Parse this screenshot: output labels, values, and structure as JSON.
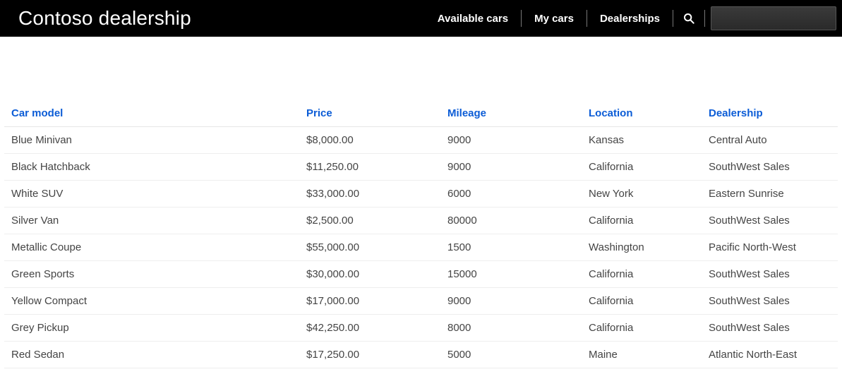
{
  "header": {
    "brand": "Contoso dealership",
    "nav": {
      "available_cars": "Available cars",
      "my_cars": "My cars",
      "dealerships": "Dealerships"
    }
  },
  "table": {
    "columns": {
      "model": "Car model",
      "price": "Price",
      "mileage": "Mileage",
      "location": "Location",
      "dealership": "Dealership"
    },
    "rows": [
      {
        "model": "Blue Minivan",
        "price": "$8,000.00",
        "mileage": "9000",
        "location": "Kansas",
        "dealership": "Central Auto"
      },
      {
        "model": "Black Hatchback",
        "price": "$11,250.00",
        "mileage": "9000",
        "location": "California",
        "dealership": "SouthWest Sales"
      },
      {
        "model": "White SUV",
        "price": "$33,000.00",
        "mileage": "6000",
        "location": "New York",
        "dealership": "Eastern Sunrise"
      },
      {
        "model": "Silver Van",
        "price": "$2,500.00",
        "mileage": "80000",
        "location": "California",
        "dealership": "SouthWest Sales"
      },
      {
        "model": "Metallic Coupe",
        "price": "$55,000.00",
        "mileage": "1500",
        "location": "Washington",
        "dealership": "Pacific North-West"
      },
      {
        "model": "Green Sports",
        "price": "$30,000.00",
        "mileage": "15000",
        "location": "California",
        "dealership": "SouthWest Sales"
      },
      {
        "model": "Yellow Compact",
        "price": "$17,000.00",
        "mileage": "9000",
        "location": "California",
        "dealership": "SouthWest Sales"
      },
      {
        "model": "Grey Pickup",
        "price": "$42,250.00",
        "mileage": "8000",
        "location": "California",
        "dealership": "SouthWest Sales"
      },
      {
        "model": "Red Sedan",
        "price": "$17,250.00",
        "mileage": "5000",
        "location": "Maine",
        "dealership": "Atlantic North-East"
      }
    ]
  }
}
